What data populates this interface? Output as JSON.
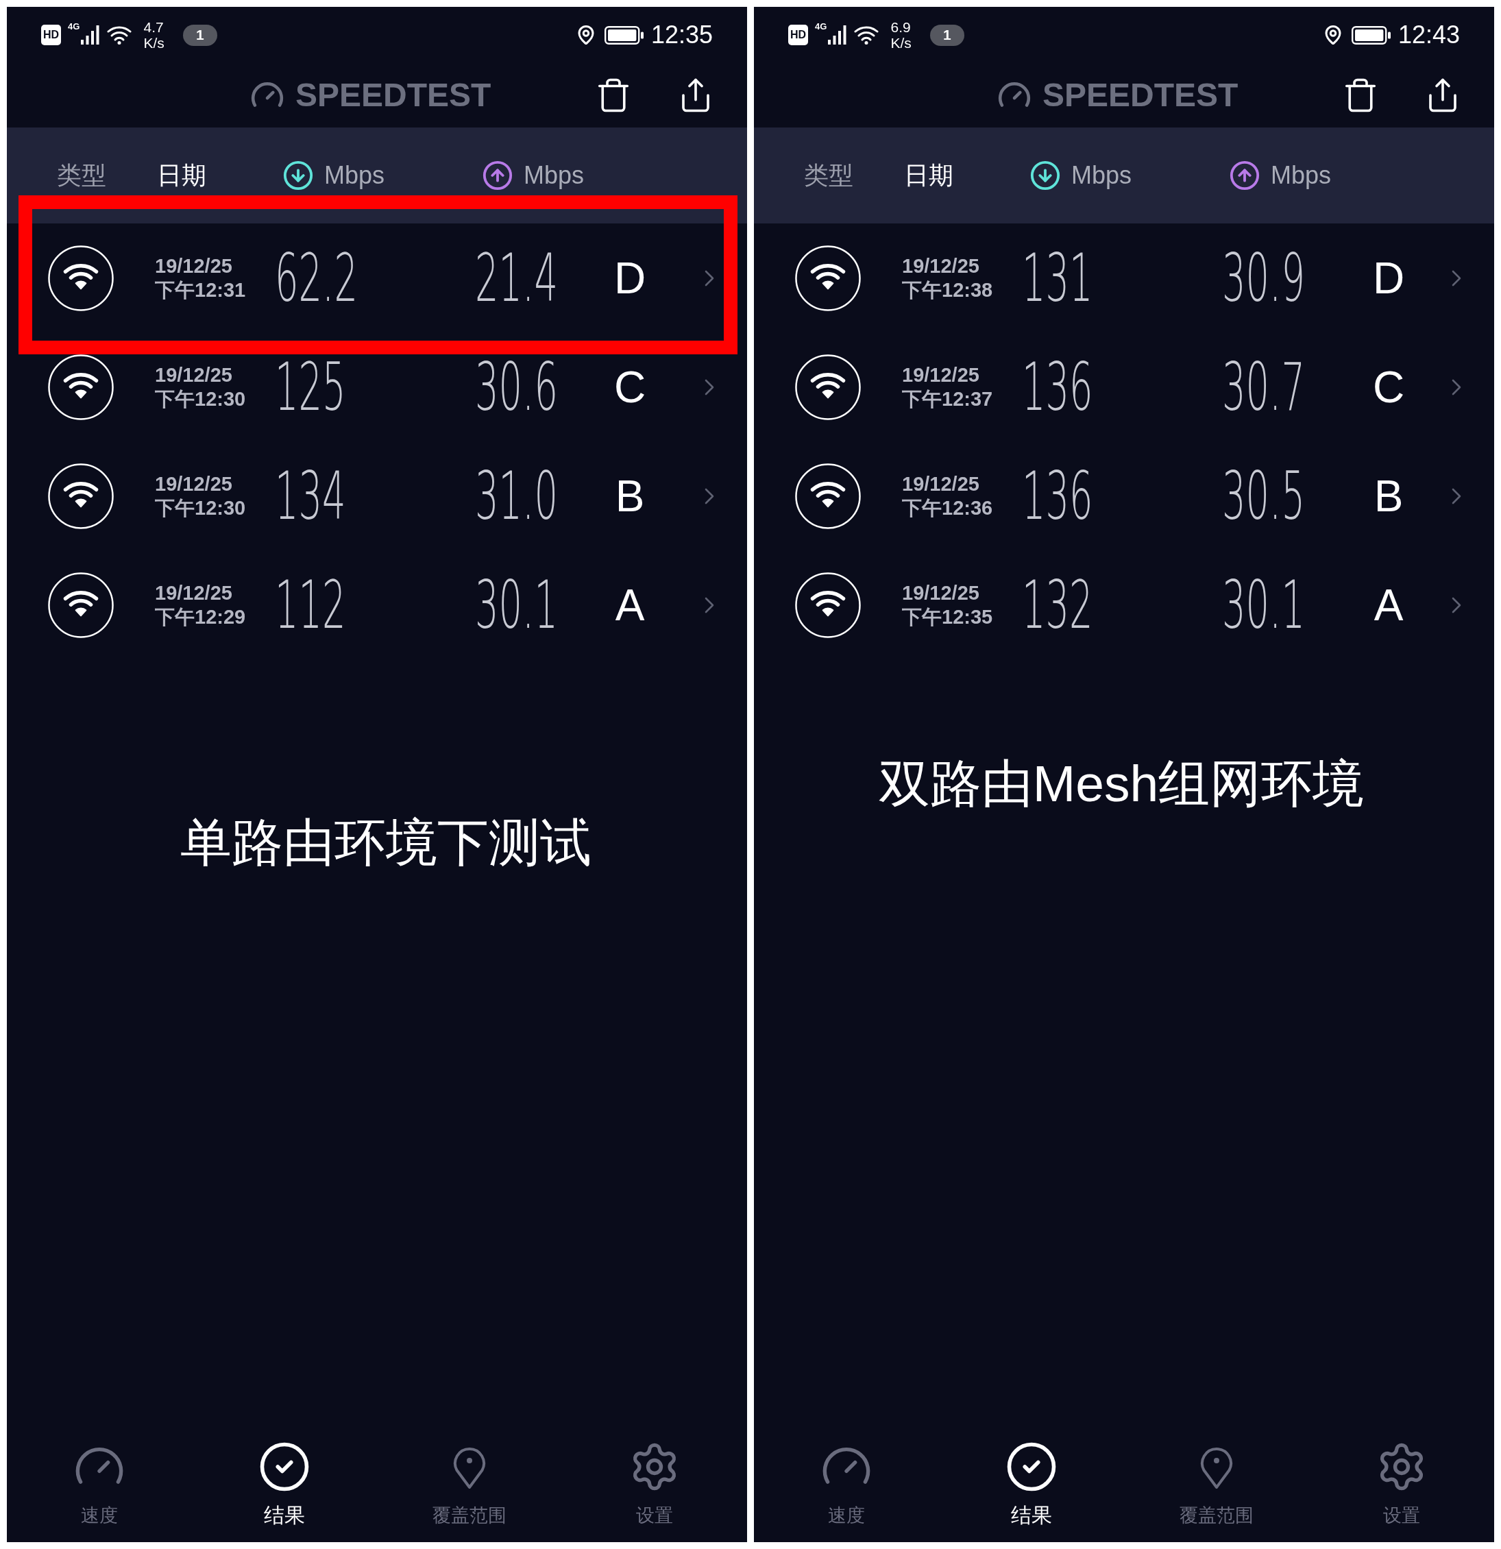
{
  "panels": [
    {
      "status_bar": {
        "hd": "HD",
        "network": "4G",
        "speed": "4.7",
        "speed_unit": "K/s",
        "notifications": "1",
        "time": "12:35"
      },
      "app_title": "SPEEDTEST",
      "columns": [
        {
          "kind": "text",
          "label": "类型",
          "selected": false
        },
        {
          "kind": "text",
          "label": "日期",
          "selected": true
        },
        {
          "kind": "download",
          "label": "Mbps",
          "color": "#5fe3d9",
          "selected": false
        },
        {
          "kind": "upload",
          "label": "Mbps",
          "color": "#b87ae8",
          "selected": false
        }
      ],
      "rows": [
        {
          "date": "19/12/25",
          "time": "下午12:31",
          "download": "62.2",
          "upload": "21.4",
          "label": "D",
          "highlighted": true
        },
        {
          "date": "19/12/25",
          "time": "下午12:30",
          "download": "125",
          "upload": "30.6",
          "label": "C",
          "highlighted": false
        },
        {
          "date": "19/12/25",
          "time": "下午12:30",
          "download": "134",
          "upload": "31.0",
          "label": "B",
          "highlighted": false
        },
        {
          "date": "19/12/25",
          "time": "下午12:29",
          "download": "112",
          "upload": "30.1",
          "label": "A",
          "highlighted": false
        }
      ],
      "caption": "单路由环境下测试",
      "nav": [
        {
          "kind": "speed",
          "label": "速度",
          "selected": false
        },
        {
          "kind": "results",
          "label": "结果",
          "selected": true
        },
        {
          "kind": "coverage",
          "label": "覆盖范围",
          "selected": false
        },
        {
          "kind": "settings",
          "label": "设置",
          "selected": false
        }
      ]
    },
    {
      "status_bar": {
        "hd": "HD",
        "network": "4G",
        "speed": "6.9",
        "speed_unit": "K/s",
        "notifications": "1",
        "time": "12:43"
      },
      "app_title": "SPEEDTEST",
      "columns": [
        {
          "kind": "text",
          "label": "类型",
          "selected": false
        },
        {
          "kind": "text",
          "label": "日期",
          "selected": true
        },
        {
          "kind": "download",
          "label": "Mbps",
          "color": "#5fe3d9",
          "selected": false
        },
        {
          "kind": "upload",
          "label": "Mbps",
          "color": "#b87ae8",
          "selected": false
        }
      ],
      "rows": [
        {
          "date": "19/12/25",
          "time": "下午12:38",
          "download": "131",
          "upload": "30.9",
          "label": "D",
          "highlighted": false
        },
        {
          "date": "19/12/25",
          "time": "下午12:37",
          "download": "136",
          "upload": "30.7",
          "label": "C",
          "highlighted": false
        },
        {
          "date": "19/12/25",
          "time": "下午12:36",
          "download": "136",
          "upload": "30.5",
          "label": "B",
          "highlighted": false
        },
        {
          "date": "19/12/25",
          "time": "下午12:35",
          "download": "132",
          "upload": "30.1",
          "label": "A",
          "highlighted": false
        }
      ],
      "caption": "双路由Mesh组网环境",
      "nav": [
        {
          "kind": "speed",
          "label": "速度",
          "selected": false
        },
        {
          "kind": "results",
          "label": "结果",
          "selected": true
        },
        {
          "kind": "coverage",
          "label": "覆盖范围",
          "selected": false
        },
        {
          "kind": "settings",
          "label": "设置",
          "selected": false
        }
      ]
    }
  ]
}
